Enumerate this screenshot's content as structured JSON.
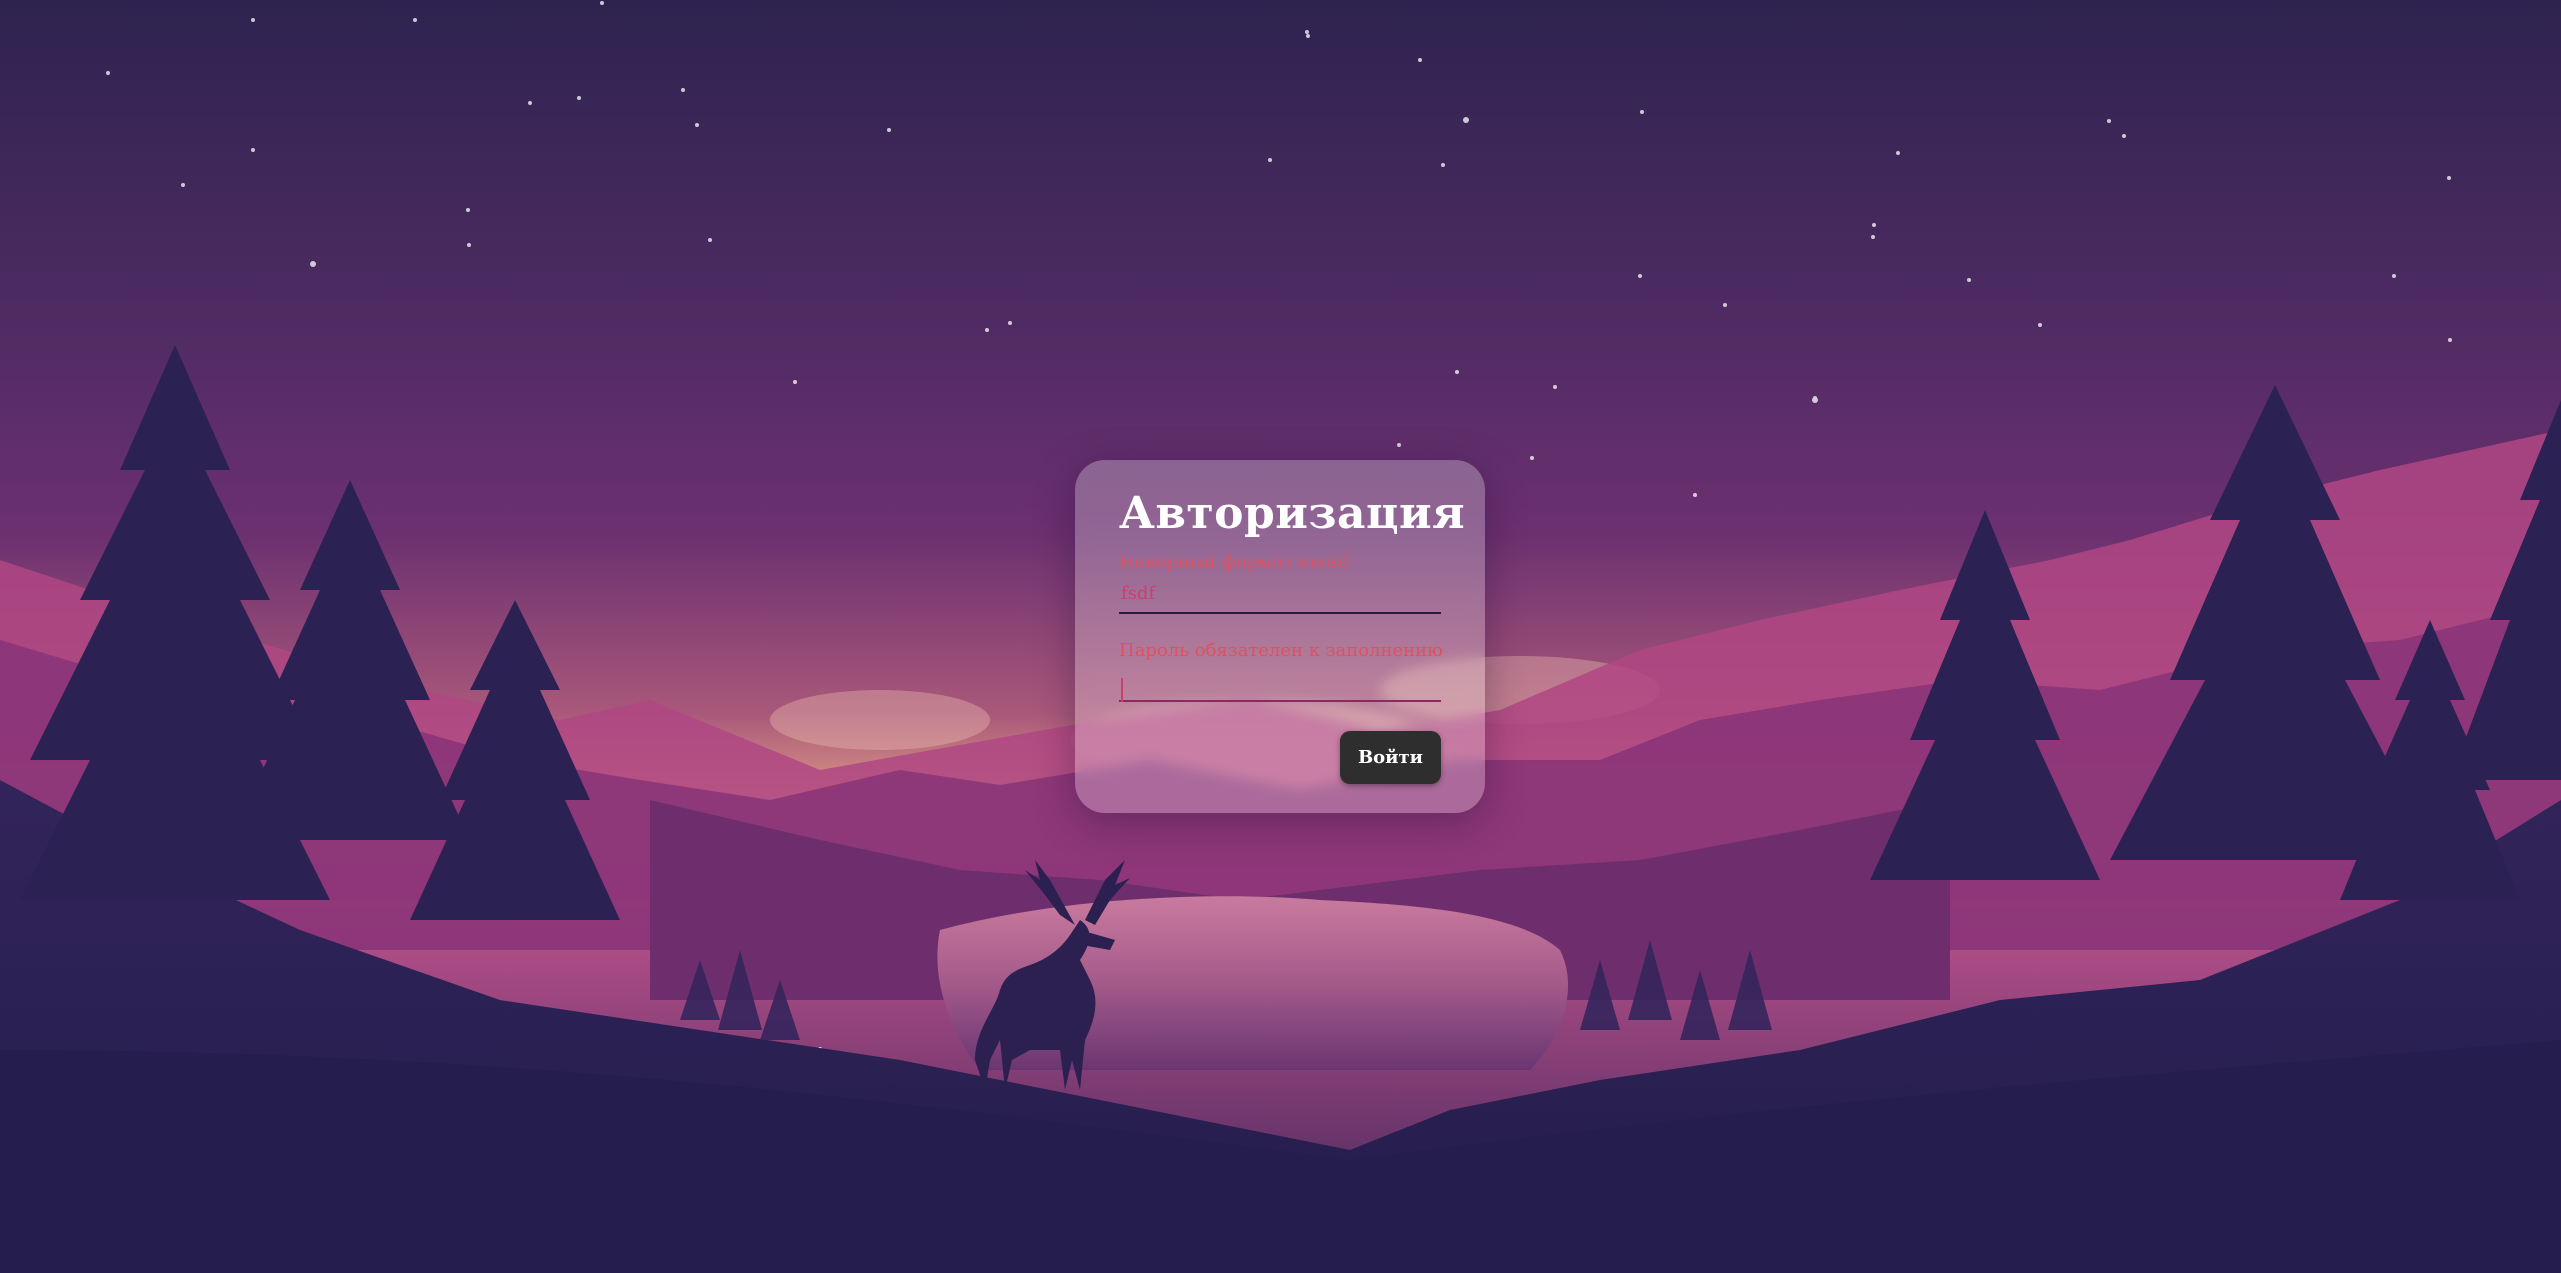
{
  "login": {
    "title": "Авторизация",
    "email": {
      "error": "Неверный формат email",
      "value": "fsdf"
    },
    "password": {
      "error": "Пароль обязателен к заполнению",
      "value": ""
    },
    "submit_label": "Войти"
  },
  "background": {
    "scene": "night mountain lake with deer and pine trees",
    "colors": {
      "sky_top": "#2f2450",
      "sky_mid": "#6a2f6f",
      "horizon": "#e8a88a",
      "mountains": "#a0407e",
      "forest": "#2a1f4d"
    }
  }
}
